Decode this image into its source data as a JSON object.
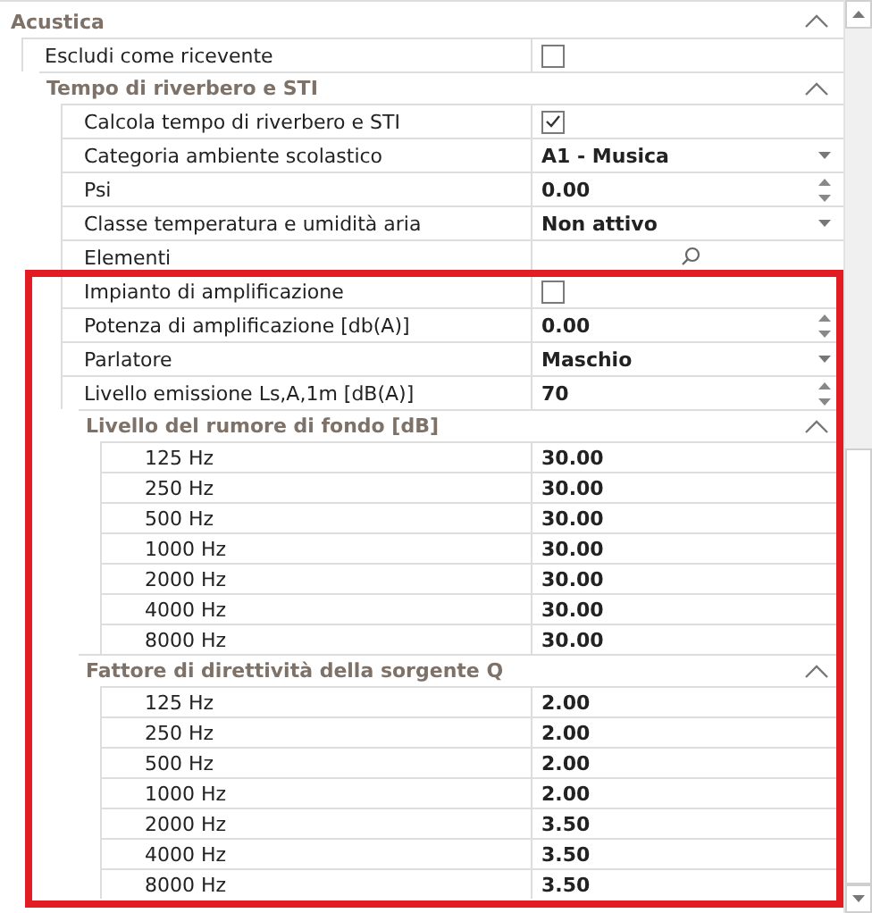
{
  "section": {
    "title": "Acustica",
    "expanded": true,
    "children": [
      {
        "kind": "checkbox",
        "label": "Escludi come ricevente",
        "checked": false
      },
      {
        "kind": "group",
        "title": "Tempo di riverbero e STI",
        "expanded": true,
        "children": [
          {
            "kind": "checkbox",
            "label": "Calcola tempo di riverbero e STI",
            "checked": true
          },
          {
            "kind": "dropdown",
            "label": "Categoria ambiente scolastico",
            "value": "A1 - Musica"
          },
          {
            "kind": "spin",
            "label": "Psi",
            "value": "0.00"
          },
          {
            "kind": "dropdown",
            "label": "Classe temperatura e umidità aria",
            "value": "Non attivo"
          },
          {
            "kind": "search",
            "label": "Elementi"
          },
          {
            "kind": "checkbox",
            "label": "Impianto di amplificazione",
            "checked": false,
            "frame_start": true
          },
          {
            "kind": "spin",
            "label": "Potenza di amplificazione [db(A)]",
            "value": "0.00"
          },
          {
            "kind": "dropdown",
            "label": "Parlatore",
            "value": "Maschio"
          },
          {
            "kind": "spin",
            "label": "Livello emissione Ls,A,1m [dB(A)]",
            "value": "70"
          },
          {
            "kind": "group",
            "title": "Livello del rumore di fondo [dB]",
            "expanded": true,
            "children": [
              {
                "kind": "text",
                "label": "125 Hz",
                "value": "30.00"
              },
              {
                "kind": "text",
                "label": "250 Hz",
                "value": "30.00"
              },
              {
                "kind": "text",
                "label": "500 Hz",
                "value": "30.00"
              },
              {
                "kind": "text",
                "label": "1000 Hz",
                "value": "30.00"
              },
              {
                "kind": "text",
                "label": "2000 Hz",
                "value": "30.00"
              },
              {
                "kind": "text",
                "label": "4000 Hz",
                "value": "30.00"
              },
              {
                "kind": "text",
                "label": "8000 Hz",
                "value": "30.00"
              }
            ]
          },
          {
            "kind": "group",
            "title": "Fattore di direttività della sorgente Q",
            "expanded": true,
            "children": [
              {
                "kind": "text",
                "label": "125 Hz",
                "value": "2.00"
              },
              {
                "kind": "text",
                "label": "250 Hz",
                "value": "2.00"
              },
              {
                "kind": "text",
                "label": "500 Hz",
                "value": "2.00"
              },
              {
                "kind": "text",
                "label": "1000 Hz",
                "value": "2.00"
              },
              {
                "kind": "text",
                "label": "2000 Hz",
                "value": "3.50"
              },
              {
                "kind": "text",
                "label": "4000 Hz",
                "value": "3.50"
              },
              {
                "kind": "text",
                "label": "8000 Hz",
                "value": "3.50"
              }
            ]
          }
        ]
      }
    ]
  }
}
